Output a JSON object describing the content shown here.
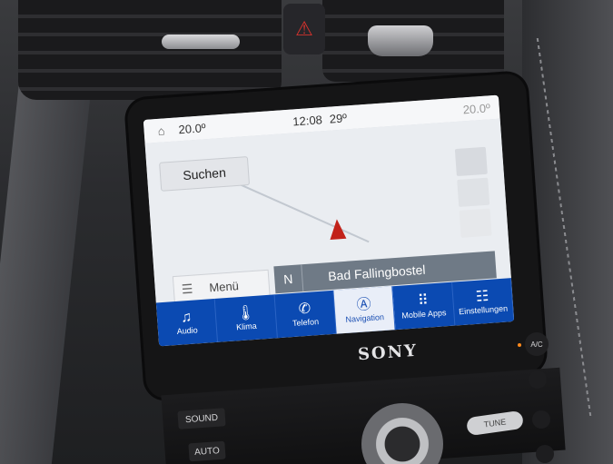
{
  "screen": {
    "status_bar": {
      "temp_left": "20.0º",
      "clock": "12:08",
      "outside_temp": "29º",
      "temp_right": "20.0º"
    },
    "map": {
      "search_label": "Suchen",
      "compass": "N",
      "location": "Bad Fallingbostel",
      "menu_label": "Menü"
    },
    "nav_tabs": [
      {
        "label": "Audio",
        "icon": "music-note-icon"
      },
      {
        "label": "Klima",
        "icon": "thermometer-icon"
      },
      {
        "label": "Telefon",
        "icon": "phone-icon"
      },
      {
        "label": "Navigation",
        "icon": "navigation-icon",
        "active": true
      },
      {
        "label": "Mobile Apps",
        "icon": "apps-grid-icon"
      },
      {
        "label": "Einstellungen",
        "icon": "settings-sliders-icon"
      }
    ]
  },
  "console": {
    "brand": "SONY",
    "sound_label": "SOUND",
    "auto_label": "AUTO",
    "tune_label": "TUNE",
    "ac_label": "A/C"
  },
  "colors": {
    "nav_bar": "#0b4ab2",
    "position_arrow": "#c2221a",
    "ac_led": "#ff8a1c",
    "hazard": "#d3322d"
  }
}
